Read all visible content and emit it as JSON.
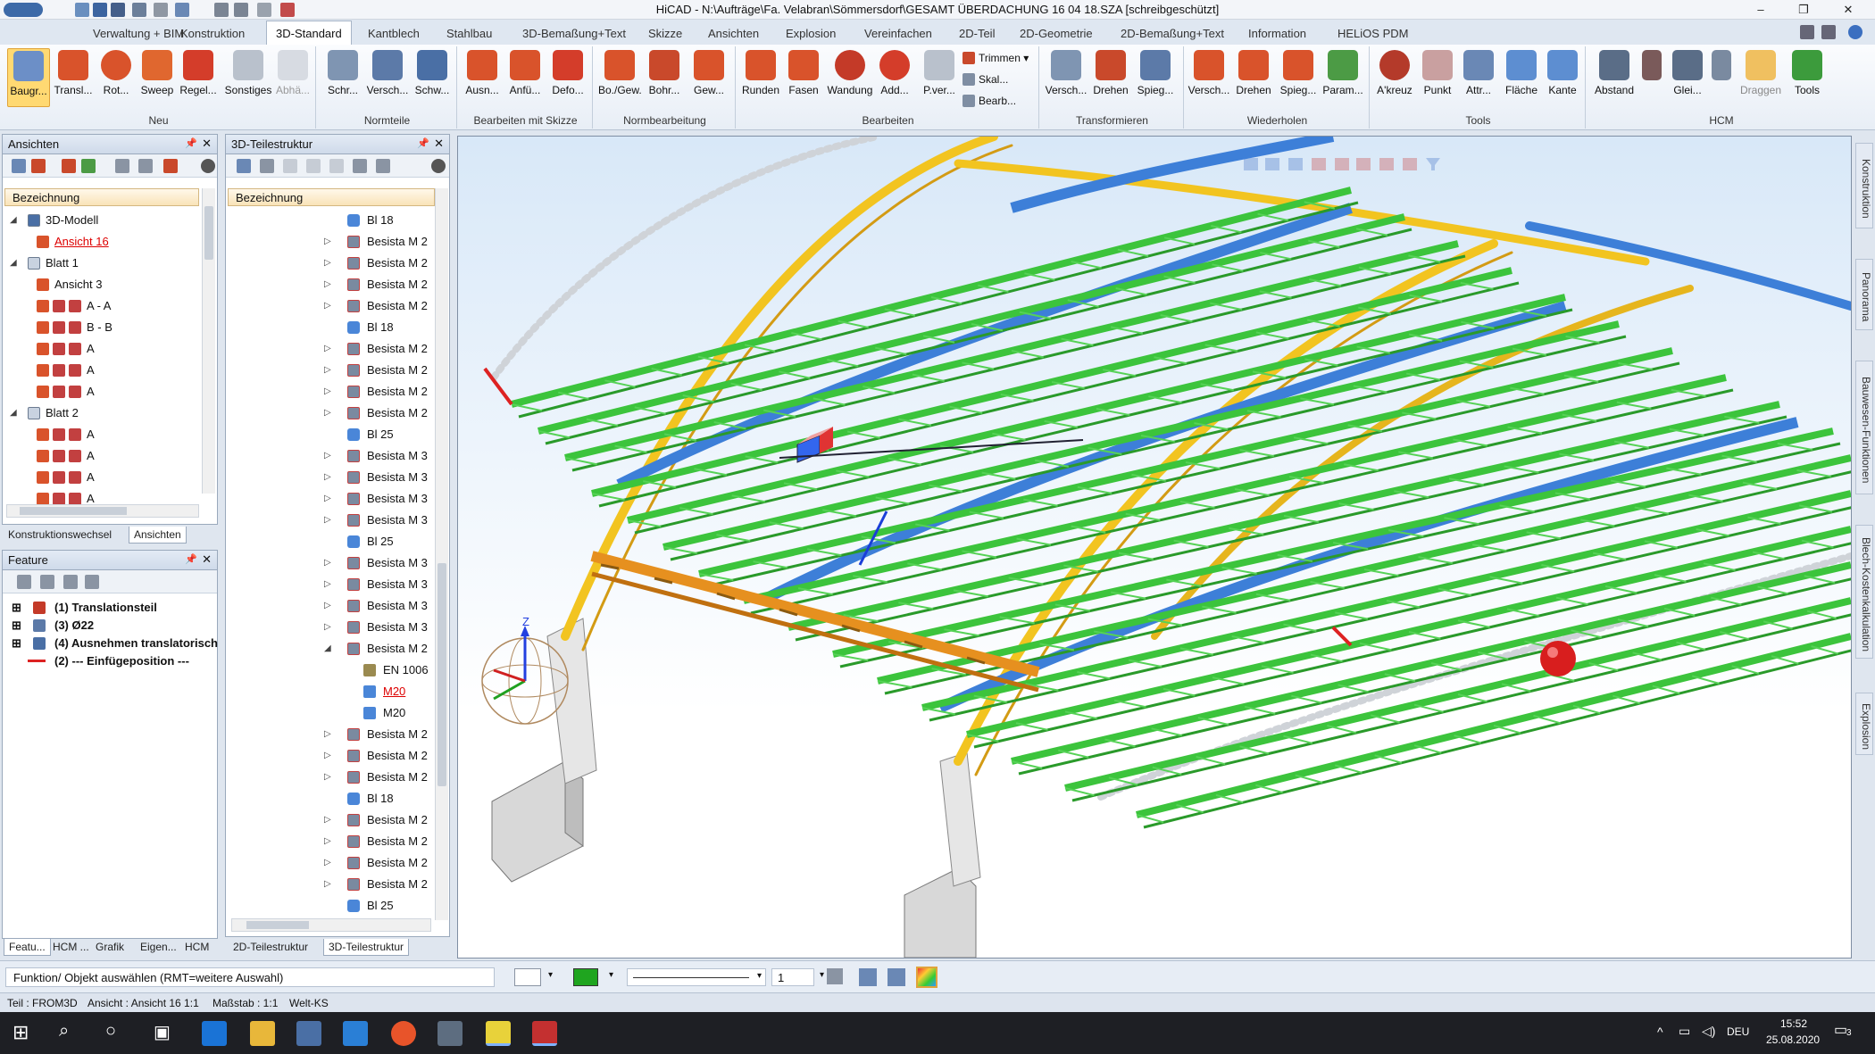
{
  "window": {
    "title": "HiCAD - N:\\Aufträge\\Fa. Velabran\\Sömmersdorf\\GESAMT ÜBERDACHUNG 16 04 18.SZA [schreibgeschützt]",
    "minimize": "–",
    "restore": "❐",
    "close": "✕"
  },
  "menu_tabs": [
    "Verwaltung + BIM",
    "Konstruktion",
    "3D-Standard",
    "Kantblech",
    "Stahlbau",
    "3D-Bemaßung+Text",
    "Skizze",
    "Ansichten",
    "Explosion",
    "Vereinfachen",
    "2D-Teil",
    "2D-Geometrie",
    "2D-Bemaßung+Text",
    "Information",
    "HELiOS PDM"
  ],
  "ribbon": {
    "groups": [
      {
        "label": "Neu",
        "buttons": [
          "Baugr...",
          "Transl...",
          "Rot...",
          "Sweep",
          "Regel...",
          "Sonstiges",
          "Abhä..."
        ]
      },
      {
        "label": "Normteile",
        "buttons": [
          "Schr...",
          "Versch...",
          "Schw..."
        ]
      },
      {
        "label": "Bearbeiten mit Skizze",
        "buttons": [
          "Ausn...",
          "Anfü...",
          "Defo..."
        ]
      },
      {
        "label": "Normbearbeitung",
        "buttons": [
          "Bo./Gew.",
          "Bohr...",
          "Gew..."
        ]
      },
      {
        "label": "Bearbeiten",
        "buttons": [
          "Runden",
          "Fasen",
          "Wandung",
          "Add...",
          "P.ver..."
        ],
        "small": [
          "Trimmen",
          "Skal...",
          "Bearb..."
        ]
      },
      {
        "label": "Transformieren",
        "buttons": [
          "Versch...",
          "Drehen",
          "Spieg..."
        ]
      },
      {
        "label": "Wiederholen",
        "buttons": [
          "Versch...",
          "Drehen",
          "Spieg...",
          "Param..."
        ]
      },
      {
        "label": "Tools",
        "buttons": [
          "A'kreuz",
          "Punkt",
          "Attr...",
          "Fläche",
          "Kante"
        ]
      },
      {
        "label": "HCM",
        "buttons": [
          "Abstand",
          "",
          "Glei...",
          "",
          "Draggen",
          "Tools"
        ]
      }
    ]
  },
  "ansichten_panel": {
    "title": "Ansichten",
    "column": "Bezeichnung",
    "rows": [
      {
        "label": "3D-Modell",
        "level": 0,
        "expand": "◢"
      },
      {
        "label": "Ansicht 16",
        "level": 1,
        "active": true
      },
      {
        "label": "Blatt 1",
        "level": 0,
        "expand": "◢"
      },
      {
        "label": "Ansicht 3",
        "level": 1
      },
      {
        "label": "A - A",
        "level": 1
      },
      {
        "label": "B - B",
        "level": 1
      },
      {
        "label": "A",
        "level": 1
      },
      {
        "label": "A",
        "level": 1
      },
      {
        "label": "A",
        "level": 1
      },
      {
        "label": "Blatt 2",
        "level": 0,
        "expand": "◢"
      },
      {
        "label": "A",
        "level": 1
      },
      {
        "label": "A",
        "level": 1
      },
      {
        "label": "A",
        "level": 1
      },
      {
        "label": "A",
        "level": 1
      }
    ],
    "tabs": [
      "Konstruktionswechsel",
      "Ansichten"
    ]
  },
  "feature_panel": {
    "title": "Feature",
    "rows": [
      "(1) Translationsteil",
      "(3) Ø22",
      "(4) Ausnehmen translatorisch",
      "(2) --- Einfügeposition ---"
    ]
  },
  "teilestruktur_panel": {
    "title": "3D-Teilestruktur",
    "column": "Bezeichnung",
    "rows": [
      {
        "label": "Bl 18",
        "type": "plate"
      },
      {
        "label": "Besista M 2",
        "type": "assy"
      },
      {
        "label": "Besista M 2",
        "type": "assy"
      },
      {
        "label": "Besista M 2",
        "type": "assy"
      },
      {
        "label": "Besista M 2",
        "type": "assy"
      },
      {
        "label": "Bl 18",
        "type": "plate"
      },
      {
        "label": "Besista M 2",
        "type": "assy"
      },
      {
        "label": "Besista M 2",
        "type": "assy"
      },
      {
        "label": "Besista M 2",
        "type": "assy"
      },
      {
        "label": "Besista M 2",
        "type": "assy"
      },
      {
        "label": "Bl 25",
        "type": "plate"
      },
      {
        "label": "Besista M 3",
        "type": "assy"
      },
      {
        "label": "Besista M 3",
        "type": "assy"
      },
      {
        "label": "Besista M 3",
        "type": "assy"
      },
      {
        "label": "Besista M 3",
        "type": "assy"
      },
      {
        "label": "Bl 25",
        "type": "plate"
      },
      {
        "label": "Besista M 3",
        "type": "assy"
      },
      {
        "label": "Besista M 3",
        "type": "assy"
      },
      {
        "label": "Besista M 3",
        "type": "assy"
      },
      {
        "label": "Besista M 3",
        "type": "assy"
      },
      {
        "label": "Besista M 2",
        "type": "assy",
        "open": true
      },
      {
        "label": "EN 1006",
        "type": "sub"
      },
      {
        "label": "M20",
        "type": "subred"
      },
      {
        "label": "M20",
        "type": "sub"
      },
      {
        "label": "Besista M 2",
        "type": "assy"
      },
      {
        "label": "Besista M 2",
        "type": "assy"
      },
      {
        "label": "Besista M 2",
        "type": "assy"
      },
      {
        "label": "Bl 18",
        "type": "plate"
      },
      {
        "label": "Besista M 2",
        "type": "assy"
      },
      {
        "label": "Besista M 2",
        "type": "assy"
      },
      {
        "label": "Besista M 2",
        "type": "assy"
      },
      {
        "label": "Besista M 2",
        "type": "assy"
      },
      {
        "label": "Bl 25",
        "type": "plate"
      }
    ]
  },
  "bottom_tabs": [
    "Featu...",
    "HCM ...",
    "Grafik",
    "Eigen...",
    "HCM",
    "2D-Teilestruktur",
    "3D-Teilestruktur"
  ],
  "side_tabs": [
    "Konstruktion",
    "Panorama",
    "Bauwesen-Funktionen",
    "Blech-Kostenkalkulation",
    "Explosion"
  ],
  "command_prompt": "Funktion/ Objekt auswählen (RMT=weitere Auswahl)",
  "layer_value": "1",
  "status": {
    "teil": "Teil : FROM3D",
    "ansicht": "Ansicht : Ansicht 16 1:1",
    "massstab": "Maßstab : 1:1",
    "ks": "Welt-KS"
  },
  "axis": {
    "z": "Z"
  },
  "taskbar": {
    "time": "15:52",
    "date": "25.08.2020",
    "lang": "DEU",
    "notif": "3"
  },
  "colors": {
    "accent": "#ffd972",
    "truss_green": "#3cc43c",
    "beam_blue": "#3d7fd8",
    "arch_yellow": "#f2c420",
    "beam_orange": "#e6901f"
  }
}
